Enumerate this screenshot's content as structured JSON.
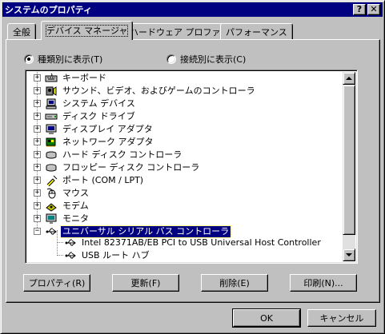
{
  "window": {
    "title": "システムのプロパティ"
  },
  "caption_buttons": {
    "help": "?",
    "close": "✕"
  },
  "tabs": [
    {
      "label": "全般"
    },
    {
      "label": "デバイス マネージャ"
    },
    {
      "label": "ハードウェア プロファイル"
    },
    {
      "label": "パフォーマンス"
    }
  ],
  "view_options": {
    "by_type": "種類別に表示(T)",
    "by_connection": "接続別に表示(C)"
  },
  "tree": {
    "items": [
      {
        "label": "キーボード",
        "icon": "keyboard-icon"
      },
      {
        "label": "サウンド、ビデオ、およびゲームのコントローラ",
        "icon": "sound-controller-icon"
      },
      {
        "label": "システム デバイス",
        "icon": "computer-icon"
      },
      {
        "label": "ディスク ドライブ",
        "icon": "disk-drive-icon"
      },
      {
        "label": "ディスプレイ アダプタ",
        "icon": "display-adapter-icon"
      },
      {
        "label": "ネットワーク アダプタ",
        "icon": "network-adapter-icon"
      },
      {
        "label": "ハード ディスク コントローラ",
        "icon": "hard-disk-controller-icon"
      },
      {
        "label": "フロッピー ディスク コントローラ",
        "icon": "floppy-controller-icon"
      },
      {
        "label": "ポート (COM / LPT)",
        "icon": "port-icon"
      },
      {
        "label": "マウス",
        "icon": "mouse-icon"
      },
      {
        "label": "モデム",
        "icon": "modem-icon"
      },
      {
        "label": "モニタ",
        "icon": "monitor-icon"
      },
      {
        "label": "ユニバーサル シリアル バス コントローラ",
        "icon": "usb-icon"
      }
    ],
    "children": [
      {
        "label": "Intel 82371AB/EB PCI to USB Universal Host Controller",
        "icon": "usb-icon"
      },
      {
        "label": "USB ルート ハブ",
        "icon": "usb-icon"
      }
    ],
    "collapsed_glyph": "+",
    "expanded_glyph": "−"
  },
  "panel_buttons": {
    "properties": "プロパティ(R)",
    "refresh": "更新(F)",
    "remove": "削除(E)",
    "print": "印刷(N)..."
  },
  "dialog_buttons": {
    "ok": "OK",
    "cancel": "キャンセル"
  },
  "colors": {
    "title_bar": "#000080",
    "selection": "#000080",
    "face": "#c0c0c0"
  }
}
